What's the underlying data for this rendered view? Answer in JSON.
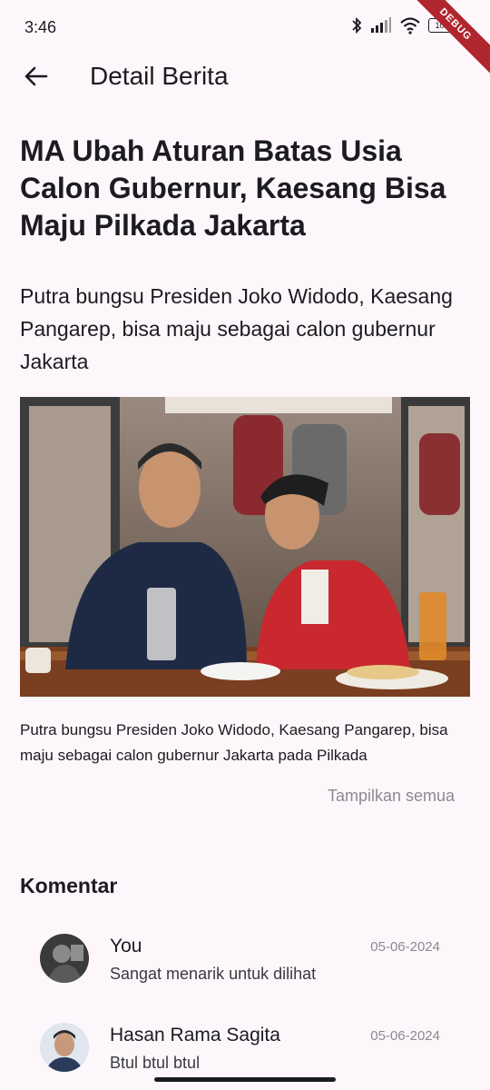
{
  "status_bar": {
    "time": "3:46",
    "battery": "100",
    "debug_label": "DEBUG"
  },
  "app_bar": {
    "title": "Detail Berita"
  },
  "article": {
    "headline": "MA Ubah Aturan Batas Usia Calon Gubernur, Kaesang Bisa Maju Pilkada Jakarta",
    "subtitle": "Putra bungsu Presiden Joko Widodo, Kaesang Pangarep, bisa maju sebagai calon gubernur Jakarta",
    "caption": "Putra bungsu Presiden Joko Widodo, Kaesang Pangarep, bisa maju sebagai calon gubernur Jakarta pada Pilkada",
    "show_all": "Tampilkan semua"
  },
  "comments": {
    "title": "Komentar",
    "items": [
      {
        "name": "You",
        "text": "Sangat menarik untuk dilihat",
        "date": "05-06-2024"
      },
      {
        "name": "Hasan Rama Sagita",
        "text": "Btul btul btul",
        "date": "05-06-2024"
      }
    ]
  },
  "colors": {
    "background": "#fdf7fb",
    "text": "#1c1b1f",
    "muted": "#8a8a8e",
    "debug": "#b0262e"
  }
}
